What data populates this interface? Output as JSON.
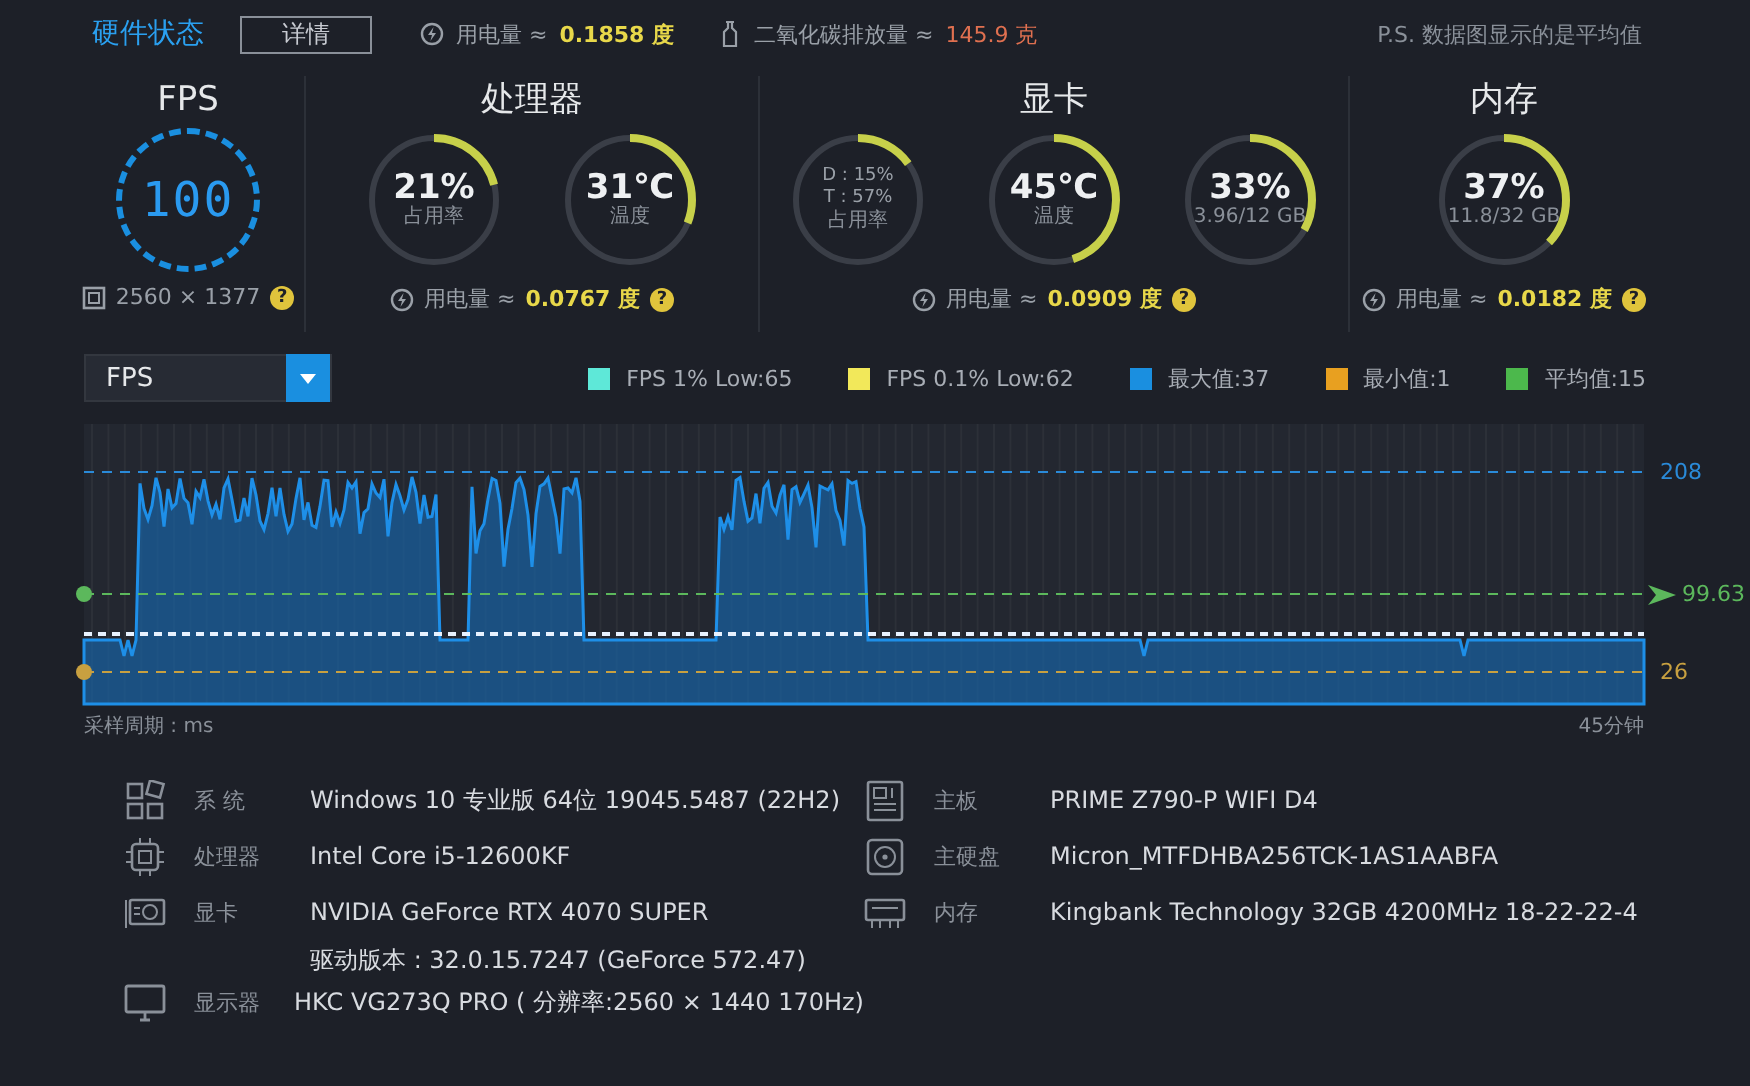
{
  "header": {
    "title": "硬件状态",
    "details_button": "详情",
    "power": {
      "label": "用电量 ≈",
      "value": "0.1858 度"
    },
    "co2": {
      "label": "二氧化碳排放量 ≈",
      "value": "145.9 克"
    },
    "note": "P.S. 数据图显示的是平均值"
  },
  "sections": [
    {
      "kind": "fps",
      "title": "FPS",
      "value": "100",
      "resolution": "2560 × 1377",
      "help": "?"
    },
    {
      "kind": "gauges",
      "title": "处理器",
      "gauges": [
        {
          "kind": "big",
          "value": "21%",
          "caption": "占用率",
          "level": 0.21
        },
        {
          "kind": "big",
          "value": "31℃",
          "caption": "温度",
          "level": 0.31
        }
      ],
      "power": {
        "label": "用电量 ≈",
        "value": "0.0767 度"
      },
      "help": "?"
    },
    {
      "kind": "gauges",
      "title": "显卡",
      "gauges": [
        {
          "kind": "small",
          "lines": [
            "D : 15%",
            "T : 57%"
          ],
          "caption": "占用率",
          "level": 0.15
        },
        {
          "kind": "big",
          "value": "45℃",
          "caption": "温度",
          "level": 0.45
        },
        {
          "kind": "big",
          "value": "33%",
          "caption": "3.96/12 GB",
          "level": 0.33
        }
      ],
      "power": {
        "label": "用电量 ≈",
        "value": "0.0909 度"
      },
      "help": "?"
    },
    {
      "kind": "gauges",
      "title": "内存",
      "gauges": [
        {
          "kind": "big",
          "value": "37%",
          "caption": "11.8/32 GB",
          "level": 0.37
        }
      ],
      "power": {
        "label": "用电量 ≈",
        "value": "0.0182 度"
      },
      "help": "?"
    }
  ],
  "chart": {
    "select": "FPS",
    "legend": [
      {
        "label": "FPS 1% Low:65",
        "color": "#5ee8d8"
      },
      {
        "label": "FPS 0.1% Low:62",
        "color": "#f2e85a"
      },
      {
        "label": "最大值:37",
        "color": "#1a8fe0"
      },
      {
        "label": "最小值:1",
        "color": "#e8a020"
      },
      {
        "label": "平均值:15",
        "color": "#4cb84c"
      }
    ],
    "reference_lines": [
      {
        "label": "208",
        "color": "#2a8ad8",
        "kind": "max"
      },
      {
        "label": "99.63",
        "color": "#5cb85c",
        "kind": "avg"
      },
      {
        "label": "26",
        "color": "#c8a040",
        "kind": "min"
      }
    ],
    "x_left": "采样周期 : ms",
    "x_right": "45分钟"
  },
  "info": {
    "left": [
      {
        "kind": "system",
        "label": "系 统",
        "value": "Windows 10 专业版 64位 19045.5487 (22H2)"
      },
      {
        "kind": "cpu",
        "label": "处理器",
        "value": "Intel Core i5-12600KF"
      },
      {
        "kind": "gpu",
        "label": "显卡",
        "value": "NVIDIA GeForce RTX 4070 SUPER",
        "extra": "驱动版本 : 32.0.15.7247 (GeForce 572.47)"
      },
      {
        "kind": "monitor",
        "label": "显示器",
        "value": "HKC VG273Q PRO ( 分辨率:2560 × 1440 170Hz)"
      }
    ],
    "right": [
      {
        "kind": "board",
        "label": "主板",
        "value": "PRIME Z790-P WIFI D4"
      },
      {
        "kind": "disk",
        "label": "主硬盘",
        "value": "Micron_MTFDHBA256TCK-1AS1AABFA"
      },
      {
        "kind": "memory",
        "label": "内存",
        "value": "Kingbank Technology 32GB 4200MHz 18-22-22-4"
      }
    ]
  }
}
